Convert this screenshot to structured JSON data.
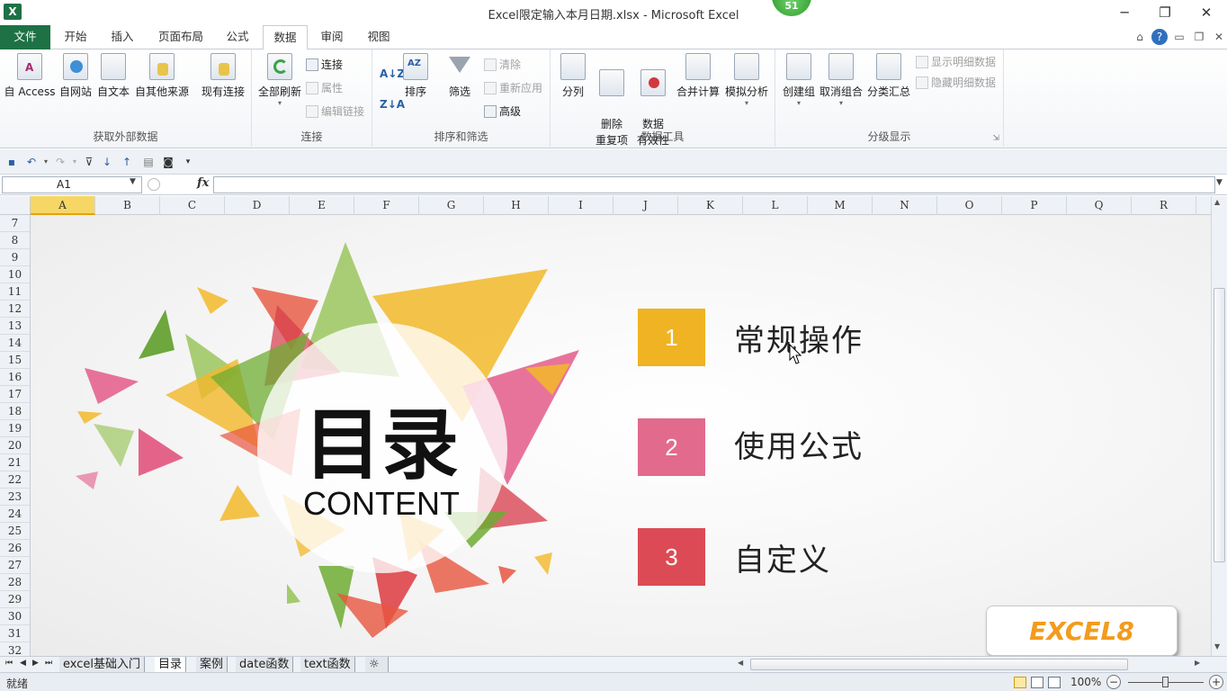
{
  "window": {
    "title": "Excel限定输入本月日期.xlsx  -  Microsoft Excel",
    "badge": "51",
    "controls": [
      "─",
      "❐",
      "✕"
    ]
  },
  "tabs": [
    {
      "label": "文件"
    },
    {
      "label": "开始"
    },
    {
      "label": "插入"
    },
    {
      "label": "页面布局"
    },
    {
      "label": "公式"
    },
    {
      "label": "数据"
    },
    {
      "label": "审阅"
    },
    {
      "label": "视图"
    }
  ],
  "ribbon": {
    "groups": {
      "external": {
        "label": "获取外部数据",
        "buttons": [
          "自 Access",
          "自网站",
          "自文本",
          "自其他来源",
          "现有连接"
        ]
      },
      "connections": {
        "label": "连接",
        "refresh": "全部刷新",
        "items": [
          "连接",
          "属性",
          "编辑链接"
        ]
      },
      "sort": {
        "label": "排序和筛选",
        "sort": "排序",
        "filter": "筛选",
        "items": [
          "清除",
          "重新应用",
          "高级"
        ]
      },
      "tools": {
        "label": "数据工具",
        "buttons": [
          "分列",
          "删除\n重复项",
          "数据\n有效性",
          "合并计算",
          "模拟分析"
        ]
      },
      "outline": {
        "label": "分级显示",
        "buttons": [
          "创建组",
          "取消组合",
          "分类汇总"
        ],
        "items": [
          "显示明细数据",
          "隐藏明细数据"
        ]
      }
    }
  },
  "formula_bar": {
    "name_box": "A1",
    "fx": "fx",
    "formula": ""
  },
  "grid": {
    "columns": [
      "A",
      "B",
      "C",
      "D",
      "E",
      "F",
      "G",
      "H",
      "I",
      "J",
      "K",
      "L",
      "M",
      "N",
      "O",
      "P",
      "Q",
      "R"
    ],
    "selected_column": "A",
    "rows": [
      "7",
      "8",
      "9",
      "10",
      "11",
      "12",
      "13",
      "14",
      "15",
      "16",
      "17",
      "18",
      "19",
      "20",
      "21",
      "22",
      "23",
      "24",
      "25",
      "26",
      "27",
      "28",
      "29",
      "30",
      "31",
      "32"
    ]
  },
  "slide": {
    "title": "目录",
    "subtitle": "CONTENT",
    "items": [
      {
        "num": "1",
        "label": "常规操作",
        "color": "#f0b323"
      },
      {
        "num": "2",
        "label": "使用公式",
        "color": "#e26a8d"
      },
      {
        "num": "3",
        "label": "自定义",
        "color": "#dc4b55"
      }
    ],
    "logo": "EXCEL8"
  },
  "sheet_tabs": [
    {
      "label": "excel基础入门",
      "active": false
    },
    {
      "label": "目录",
      "active": true
    },
    {
      "label": "案例",
      "active": false
    },
    {
      "label": "date函数",
      "active": false
    },
    {
      "label": "text函数",
      "active": false
    }
  ],
  "status": {
    "text": "就绪",
    "zoom": "100%"
  },
  "colors": {
    "excel_green": "#1e7145",
    "selection_yellow": "#f6d664"
  }
}
